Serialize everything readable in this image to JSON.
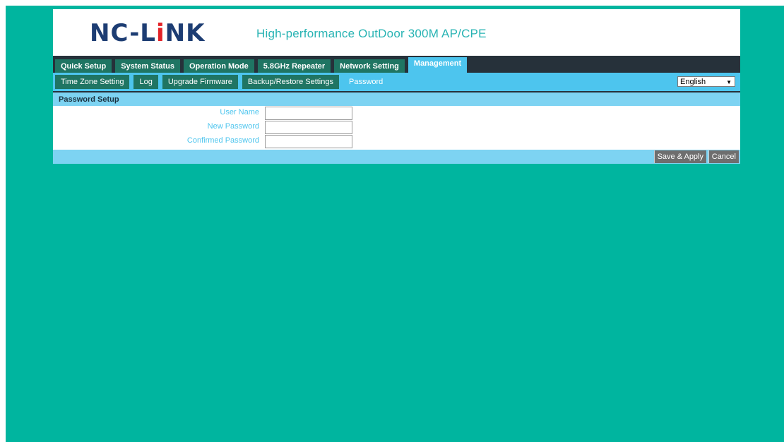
{
  "brand": {
    "logo_prefix": "NC-L",
    "logo_accent": "i",
    "logo_suffix": "NK",
    "tagline": "High-performance OutDoor 300M AP/CPE"
  },
  "main_nav": [
    {
      "label": "Quick Setup",
      "active": false
    },
    {
      "label": "System Status",
      "active": false
    },
    {
      "label": "Operation Mode",
      "active": false
    },
    {
      "label": "5.8GHz Repeater",
      "active": false
    },
    {
      "label": "Network Setting",
      "active": false
    },
    {
      "label": "Management",
      "active": true
    }
  ],
  "sub_nav": [
    {
      "label": "Time Zone Setting",
      "active": false
    },
    {
      "label": "Log",
      "active": false
    },
    {
      "label": "Upgrade Firmware",
      "active": false
    },
    {
      "label": "Backup/Restore Settings",
      "active": false
    },
    {
      "label": "Password",
      "active": true
    }
  ],
  "language": {
    "selected": "English",
    "arrow": "▼"
  },
  "section": {
    "title": "Password Setup"
  },
  "form": {
    "fields": [
      {
        "label": "User Name",
        "value": ""
      },
      {
        "label": "New Password",
        "value": ""
      },
      {
        "label": "Confirmed Password",
        "value": ""
      }
    ]
  },
  "actions": {
    "save_label": "Save & Apply",
    "cancel_label": "Cancel"
  },
  "colors": {
    "page_background": "#00b59f",
    "nav_dark": "#26313a",
    "tab_green": "#1f7563",
    "accent_blue": "#4dc5ee",
    "light_blue": "#7dd3f2",
    "logo_navy": "#1d3d73",
    "logo_red": "#e32227",
    "tagline_teal": "#27b3b3"
  }
}
